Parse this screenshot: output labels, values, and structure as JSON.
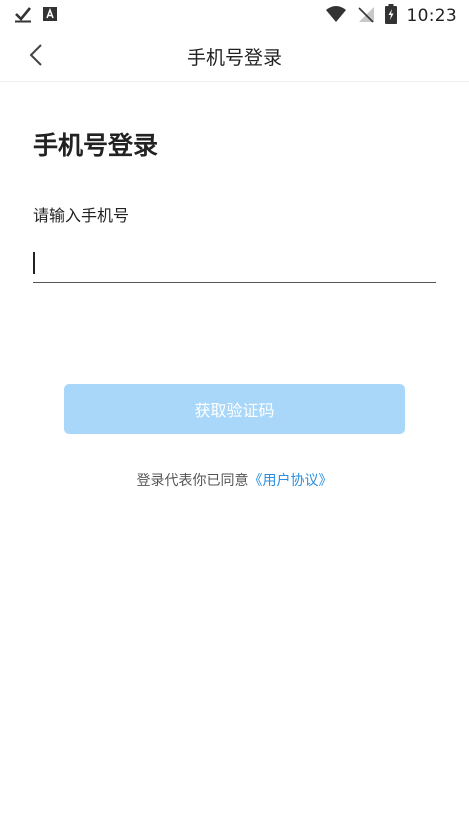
{
  "status_bar": {
    "time": "10:23",
    "icons": [
      "download-check-icon",
      "app-a-icon",
      "wifi-icon",
      "no-signal-icon",
      "battery-charging-icon"
    ]
  },
  "nav": {
    "title": "手机号登录"
  },
  "page": {
    "heading": "手机号登录",
    "field_label": "请输入手机号",
    "phone_value": ""
  },
  "actions": {
    "get_code_label": "获取验证码"
  },
  "agreement": {
    "prefix": "登录代表你已同意",
    "link_text": "《用户协议》"
  },
  "colors": {
    "button_disabled": "#a9d7fa",
    "link": "#2a8fe0"
  }
}
